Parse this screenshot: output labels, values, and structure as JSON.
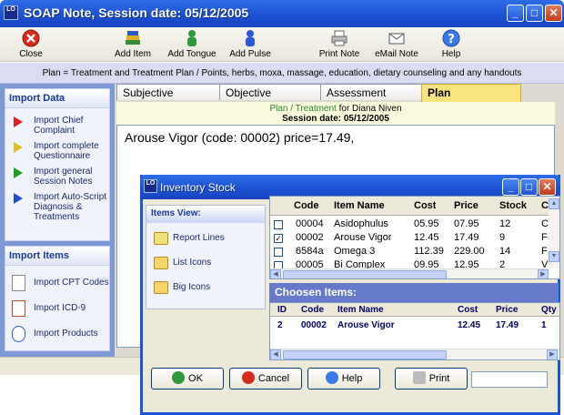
{
  "window": {
    "title": "SOAP Note, Session date: 05/12/2005",
    "icon_text": "LO"
  },
  "toolbar": {
    "close": "Close",
    "add_item": "Add Item",
    "add_tongue": "Add Tongue",
    "add_pulse": "Add Pulse",
    "print_note": "Print Note",
    "email_note": "eMail Note",
    "help": "Help"
  },
  "infobar": "Plan = Treatment and Treatment Plan / Points, herbs, moxa, massage, education, dietary counseling and any handouts",
  "import_data": {
    "title": "Import Data",
    "items": [
      {
        "label": "Import Chief Complaint",
        "color": "#e02020"
      },
      {
        "label": "Import complete Questionnaire",
        "color": "#e0c020"
      },
      {
        "label": "Import general Session Notes",
        "color": "#20a020"
      },
      {
        "label": "Import Auto-Script Diagnosis & Treatments",
        "color": "#2050d0"
      }
    ]
  },
  "import_items": {
    "title": "Import Items",
    "items": [
      "Import CPT Codes",
      "Import ICD-9",
      "Import Products"
    ]
  },
  "tabs": [
    "Subjective",
    "Objective",
    "Assessment",
    "Plan"
  ],
  "plan_header": {
    "part1": "Plan / Treatment",
    "part2": " for Diana Niven",
    "session": "Session date: 05/12/2005"
  },
  "note_text": "Arouse Vigor (code: 00002) price=17.49,",
  "dialog": {
    "title": "Inventory Stock",
    "icon_text": "LO",
    "items_view": {
      "title": "Items View:",
      "options": [
        "Report Lines",
        "List Icons",
        "Big Icons"
      ]
    },
    "stock": {
      "headers": [
        "Code",
        "Item Name",
        "Cost",
        "Price",
        "Stock",
        "C"
      ],
      "rows": [
        {
          "checked": "",
          "code": "00004",
          "name": "Asidophulus",
          "cost": "05.95",
          "price": "07.95",
          "stock": "12",
          "c": "C"
        },
        {
          "checked": "✓",
          "code": "00002",
          "name": "Arouse Vigor",
          "cost": "12.45",
          "price": "17.49",
          "stock": "9",
          "c": "F"
        },
        {
          "checked": "",
          "code": "6584a",
          "name": "Omega 3",
          "cost": "112.39",
          "price": "229.00",
          "stock": "14",
          "c": "F"
        },
        {
          "checked": "",
          "code": "00005",
          "name": "Bi Complex",
          "cost": "09.95",
          "price": "12.95",
          "stock": "2",
          "c": "V"
        }
      ]
    },
    "chosen_label": "Choosen Items:",
    "chosen": {
      "headers": [
        "ID",
        "Code",
        "Item Name",
        "Cost",
        "Price",
        "Qty"
      ],
      "rows": [
        {
          "id": "2",
          "code": "00002",
          "name": "Arouse Vigor",
          "cost": "12.45",
          "price": "17.49",
          "qty": "1"
        }
      ]
    },
    "buttons": {
      "ok": "OK",
      "cancel": "Cancel",
      "help": "Help",
      "print": "Print"
    }
  }
}
